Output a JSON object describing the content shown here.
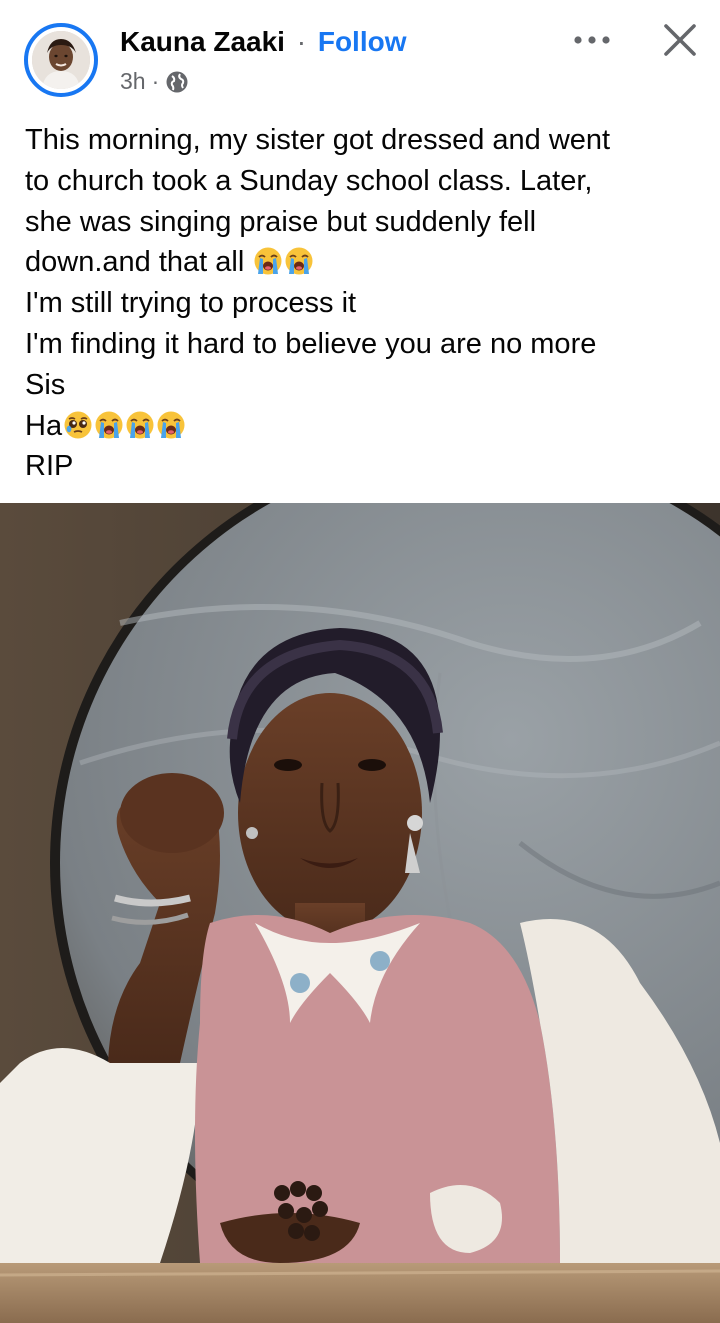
{
  "post": {
    "author": "Kauna Zaaki",
    "separator": "·",
    "follow_label": "Follow",
    "time": "3h",
    "meta_separator": "·",
    "audience_icon": "globe-icon",
    "more_icon": "more-horizontal-icon",
    "close_icon": "close-icon",
    "text_lines": [
      {
        "text": "This morning, my sister got dressed and went",
        "emojis": []
      },
      {
        "text": "to church took a Sunday school class. Later,",
        "emojis": []
      },
      {
        "text": "she was singing praise but suddenly fell",
        "emojis": []
      },
      {
        "text": "down.and that all ",
        "emojis": [
          "loudly-crying-face",
          "loudly-crying-face"
        ]
      },
      {
        "text": "I'm still trying to process it",
        "emojis": []
      },
      {
        "text": "I'm finding it hard to believe you are no more",
        "emojis": []
      },
      {
        "text": "Sis",
        "emojis": []
      },
      {
        "text": "Ha",
        "emojis": [
          "pleading-face",
          "loudly-crying-face",
          "loudly-crying-face",
          "loudly-crying-face"
        ]
      },
      {
        "text": "RIP",
        "emojis": []
      }
    ],
    "photo_subject": "portrait-photo"
  },
  "colors": {
    "accent": "#1877f2",
    "secondary_text": "#65676b",
    "primary_text": "#050505"
  }
}
